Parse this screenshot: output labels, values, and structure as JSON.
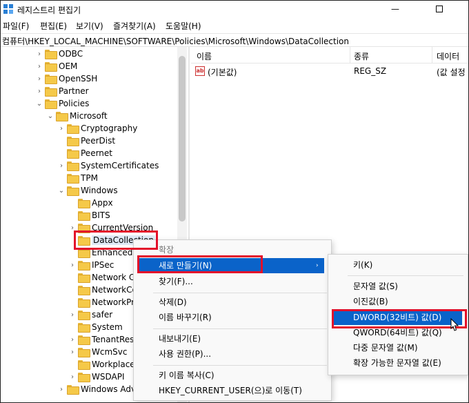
{
  "window": {
    "title": "레지스트리 편집기",
    "minimize_glyph": "—"
  },
  "menu": [
    "파일(F)",
    "편집(E)",
    "보기(V)",
    "즐겨찾기(A)",
    "도움말(H)"
  ],
  "address": "컴퓨터\\HKEY_LOCAL_MACHINE\\SOFTWARE\\Policies\\Microsoft\\Windows\\DataCollection",
  "tree": [
    {
      "label": "ODBC",
      "chev": "›"
    },
    {
      "label": "OEM",
      "chev": "›"
    },
    {
      "label": "OpenSSH",
      "chev": "›"
    },
    {
      "label": "Partner",
      "chev": "›"
    },
    {
      "label": "Policies",
      "chev": "⌄"
    },
    {
      "label": "Microsoft",
      "chev": "⌄"
    },
    {
      "label": "Cryptography",
      "chev": "›"
    },
    {
      "label": "PeerDist",
      "chev": ""
    },
    {
      "label": "Peernet",
      "chev": ""
    },
    {
      "label": "SystemCertificates",
      "chev": "›"
    },
    {
      "label": "TPM",
      "chev": ""
    },
    {
      "label": "Windows",
      "chev": "⌄"
    },
    {
      "label": "Appx",
      "chev": ""
    },
    {
      "label": "BITS",
      "chev": ""
    },
    {
      "label": "CurrentVersion",
      "chev": "›"
    },
    {
      "label": "DataCollection",
      "chev": ""
    },
    {
      "label": "EnhancedS",
      "chev": ""
    },
    {
      "label": "IPSec",
      "chev": "›"
    },
    {
      "label": "Network C",
      "chev": ""
    },
    {
      "label": "NetworkCo",
      "chev": ""
    },
    {
      "label": "NetworkPr",
      "chev": ""
    },
    {
      "label": "safer",
      "chev": "›"
    },
    {
      "label": "System",
      "chev": ""
    },
    {
      "label": "TenantRest",
      "chev": "›"
    },
    {
      "label": "WcmSvc",
      "chev": "›"
    },
    {
      "label": "Workplace",
      "chev": ""
    },
    {
      "label": "WSDAPI",
      "chev": "›"
    },
    {
      "label": "Windows Adv",
      "chev": "›"
    }
  ],
  "list": {
    "columns": [
      "이름",
      "종류",
      "데이터"
    ],
    "rows": [
      {
        "name": "(기본값)",
        "type": "REG_SZ",
        "data": "(값 설정"
      }
    ],
    "icon_text": "ab"
  },
  "context_menu": {
    "header": "확장",
    "items": [
      "새로 만들기(N)",
      "찾기(F)...",
      "삭제(D)",
      "이름 바꾸기(R)",
      "내보내기(E)",
      "사용 권한(P)...",
      "키 이름 복사(C)",
      "HKEY_CURRENT_USER(으)로 이동(T)"
    ],
    "submenu_arrow": "›"
  },
  "submenu": {
    "items": [
      "키(K)",
      "문자열 값(S)",
      "이진값(B)",
      "DWORD(32비트) 값(D)",
      "QWORD(64비트) 값(Q)",
      "다중 문자열 값(M)",
      "확장 가능한 문자열 값(E)"
    ]
  },
  "colors": {
    "highlight": "#0a63c9",
    "redbox": "#e3102a",
    "folder": "#f5c949"
  }
}
